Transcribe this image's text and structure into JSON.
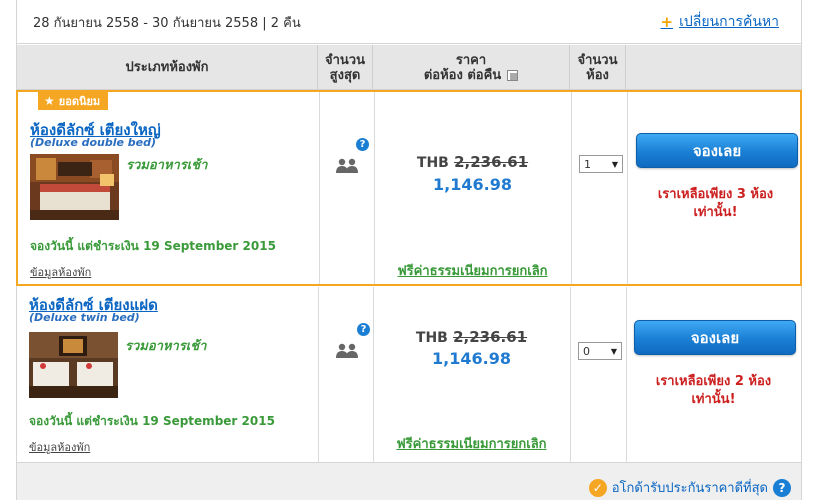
{
  "search": {
    "dates": "28 กันยายน 2558 - 30 กันยายน 2558 | 2 คืน",
    "change_plus": "+",
    "change_label": "เปลี่ยนการค้นหา"
  },
  "table": {
    "headers": {
      "room_type": "ประเภทห้องพัก",
      "max_line1": "จำนวน",
      "max_line2": "สูงสุด",
      "price_line1": "ราคา",
      "price_line2": "ต่อห้อง ต่อคืน",
      "rooms_line1": "จำนวน",
      "rooms_line2": "ห้อง"
    }
  },
  "rooms": [
    {
      "badge": "ยอดนิยม",
      "name": "ห้องดีลักซ์ เตียงใหญ่",
      "subtitle": "(Deluxe double bed)",
      "breakfast": "รวมอาหารเช้า",
      "book_note": "จองวันนี้ แต่ชำระเงิน 19 September 2015",
      "info_link": "ข้อมูลห้องพัก",
      "help": "?",
      "currency": "THB",
      "old_price": "2,236.61",
      "new_price": "1,146.98",
      "free_cancel": "ฟรีค่าธรรมเนียมการยกเลิก",
      "qty": "1",
      "book_button": "จองเลย",
      "left_line1": "เราเหลือเพียง 3 ห้อง",
      "left_line2": "เท่านั้น!"
    },
    {
      "name": "ห้องดีลักซ์ เตียงแฝด",
      "subtitle": "(Deluxe twin bed)",
      "breakfast": "รวมอาหารเช้า",
      "book_note": "จองวันนี้ แต่ชำระเงิน 19 September 2015",
      "info_link": "ข้อมูลห้องพัก",
      "help": "?",
      "currency": "THB",
      "old_price": "2,236.61",
      "new_price": "1,146.98",
      "free_cancel": "ฟรีค่าธรรมเนียมการยกเลิก",
      "qty": "0",
      "book_button": "จองเลย",
      "left_line1": "เราเหลือเพียง 2 ห้อง",
      "left_line2": "เท่านั้น!"
    }
  ],
  "footer": {
    "guarantee": "อโกด้ารับประกันราคาดีที่สุด",
    "check": "✓",
    "help": "?"
  },
  "icons": {
    "star": "star-icon",
    "people": "people-icon",
    "help": "help-icon",
    "copy": "copy-icon",
    "check": "check-icon",
    "dropdown": "chevron-down-icon"
  },
  "colors": {
    "link": "#0a66c2",
    "highlight_border": "#f5a623",
    "price": "#1f7ad0",
    "green": "#3a9a3a",
    "warning": "#cc1f1f",
    "button": "#1a7fd4"
  }
}
